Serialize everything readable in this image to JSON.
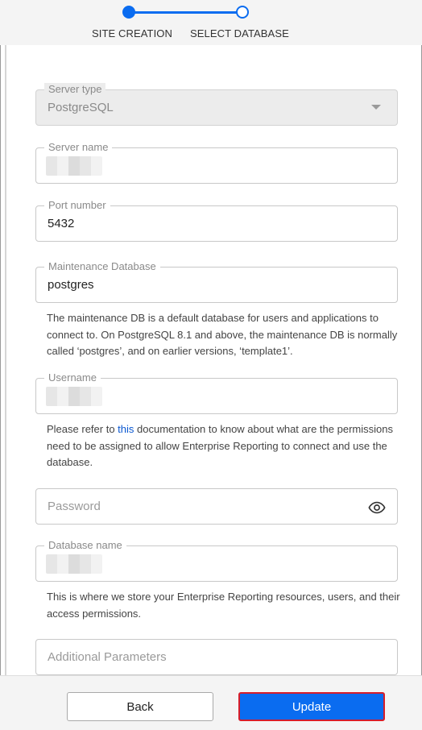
{
  "stepper": {
    "steps": [
      {
        "label": "SITE CREATION",
        "state": "completed"
      },
      {
        "label": "SELECT DATABASE",
        "state": "current"
      }
    ]
  },
  "form": {
    "server_type": {
      "label": "Server type",
      "value": "PostgreSQL",
      "disabled": true
    },
    "server_name": {
      "label": "Server name",
      "value_redacted": true
    },
    "port_number": {
      "label": "Port number",
      "value": "5432"
    },
    "maintenance_db": {
      "label": "Maintenance Database",
      "value": "postgres",
      "help": "The maintenance DB is a default database for users and applications to connect to. On PostgreSQL 8.1 and above, the maintenance DB is normally called ‘postgres’, and on earlier versions, ‘template1’."
    },
    "username": {
      "label": "Username",
      "value_redacted": true,
      "help_prefix": "Please refer to ",
      "help_link": "this",
      "help_suffix": " documentation to know about what are the permissions need to be assigned to allow Enterprise Reporting to connect and use the database."
    },
    "password": {
      "placeholder": "Password",
      "icon": "eye-icon"
    },
    "database_name": {
      "label": "Database name",
      "value_redacted": true,
      "help": "This is where we store your Enterprise Reporting resources, users, and their access permissions."
    },
    "additional_parameters": {
      "placeholder": "Additional Parameters"
    }
  },
  "footer": {
    "back_label": "Back",
    "update_label": "Update"
  },
  "colors": {
    "accent": "#0a6cf0",
    "link": "#0a57d0",
    "focus_outline": "#d61e2a"
  }
}
